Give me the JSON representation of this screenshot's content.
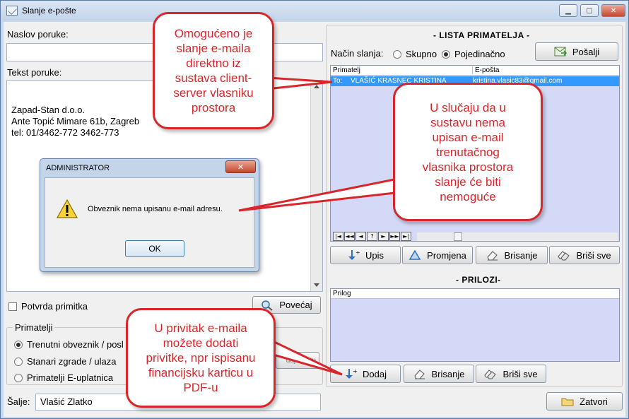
{
  "window": {
    "title": "Slanje e-pošte"
  },
  "form": {
    "subject_label": "Naslov poruke:",
    "subject_value": "",
    "body_label": "Tekst poruke:",
    "body_lines": [
      "Zapad-Stan d.o.o.",
      "Ante Topić Mimare 61b, Zagreb",
      "tel: 01/3462-772 3462-773"
    ],
    "receipt_label": "Potvrda primitka",
    "enlarge_label": "Povećaj",
    "recipients_group_title": "Primatelji",
    "recipient_options": [
      "Trenutni obveznik / posl",
      "Stanari zgrade / ulaza",
      "Primatelji E-uplatnica"
    ],
    "add_to_list_label": "daj u listu",
    "sender_label": "Šalje:",
    "sender_value": "Vlašić Zlatko"
  },
  "recipients": {
    "title": "- LISTA PRIMATELJA -",
    "mode_label": "Način slanja:",
    "mode_options": [
      "Skupno",
      "Pojedinačno"
    ],
    "selected_mode": "Pojedinačno",
    "send_label": "Pošalji",
    "col_recipient": "Primatelj",
    "col_email": "E-pošta",
    "row": {
      "prefix": "To:",
      "name": "VLAŠIĆ KRASNEC KRISTINA",
      "email": "kristina.vlasic83@gmail.com"
    },
    "nav_buttons": [
      "|◄",
      "◄◄",
      "◄",
      "?",
      "►",
      "►►",
      "►|"
    ],
    "buttons": [
      "Upis",
      "Promjena",
      "Brisanje",
      "Briši sve"
    ]
  },
  "attachments": {
    "title": "- PRILOZI-",
    "col_attachment": "Prilog",
    "buttons": [
      "Dodaj",
      "Brisanje",
      "Briši sve"
    ]
  },
  "close_label": "Zatvori",
  "dialog": {
    "title": "ADMINISTRATOR",
    "message": "Obveznik nema upisanu e-mail adresu.",
    "ok_label": "OK"
  },
  "callouts": {
    "top": [
      "Omogućeno je",
      "slanje e-maila",
      "direktno iz",
      "sustava client-",
      "server vlasniku",
      "prostora"
    ],
    "right": [
      "U slučaju da u",
      "sustavu nema",
      "upisan e-mail",
      "trenutačnog",
      "vlasnika prostora",
      "slanje će biti",
      "nemoguće"
    ],
    "bottom": [
      "U privitak e-maila",
      "možete dodati",
      "privitke, npr ispisanu",
      "financijsku karticu u",
      "PDF-u"
    ]
  },
  "colors": {
    "accent_red": "#d9262a",
    "grid_bg": "#d3d9f6",
    "selection": "#3399ff"
  }
}
